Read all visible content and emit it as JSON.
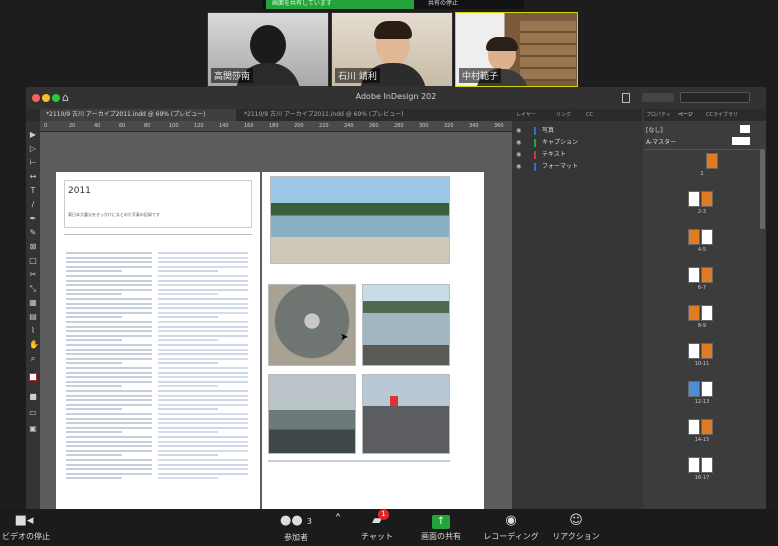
{
  "participants": [
    {
      "name": "高関莎南"
    },
    {
      "name": "石川 靖利"
    },
    {
      "name": "中村範子"
    }
  ],
  "app": {
    "title": "Adobe InDesign 202",
    "tab_active": "*2110/9 古川 アーカイブ2011.indd @ 69% (プレビュー)",
    "tab_inactive": "*2110/9 古川 アーカイブ2011.indd @ 69% (プレビュー)",
    "ruler": [
      "0",
      "20",
      "40",
      "60",
      "80",
      "100",
      "120",
      "140",
      "160",
      "180",
      "200",
      "220",
      "240",
      "260",
      "280",
      "300",
      "320",
      "340",
      "360"
    ]
  },
  "document": {
    "title": "2011",
    "subtitle": "東日本大震災をきっかけにまとめた写真の記録です"
  },
  "layers_panel": {
    "tabs": [
      "レイヤー",
      "リンク",
      "CC"
    ],
    "layers": [
      {
        "name": "写真",
        "color": "#2e6fd0"
      },
      {
        "name": "キャプション",
        "color": "#27a447"
      },
      {
        "name": "テキスト",
        "color": "#d23a2e"
      },
      {
        "name": "フォーマット",
        "color": "#2e6fd0"
      }
    ]
  },
  "pages_panel": {
    "tabs": [
      "プロパティ",
      "ページ",
      "CCライブラリ"
    ],
    "master_none": "[なし]",
    "master_a": "A-マスター",
    "thumb_labels": [
      "1",
      "2-3",
      "4-5",
      "6-7",
      "8-9",
      "10-11",
      "12-13",
      "14-15",
      "16-17"
    ]
  },
  "zoom_bar": {
    "participants_count": "3",
    "chat_badge": "1",
    "items": [
      {
        "label": "ビデオの停止"
      },
      {
        "label": "参加者"
      },
      {
        "label": "チャット"
      },
      {
        "label": "画面の共有"
      },
      {
        "label": "レコーディング"
      },
      {
        "label": "リアクション"
      }
    ]
  },
  "share_bar": {
    "status": "画面を共有しています",
    "stop": "共有の停止"
  }
}
